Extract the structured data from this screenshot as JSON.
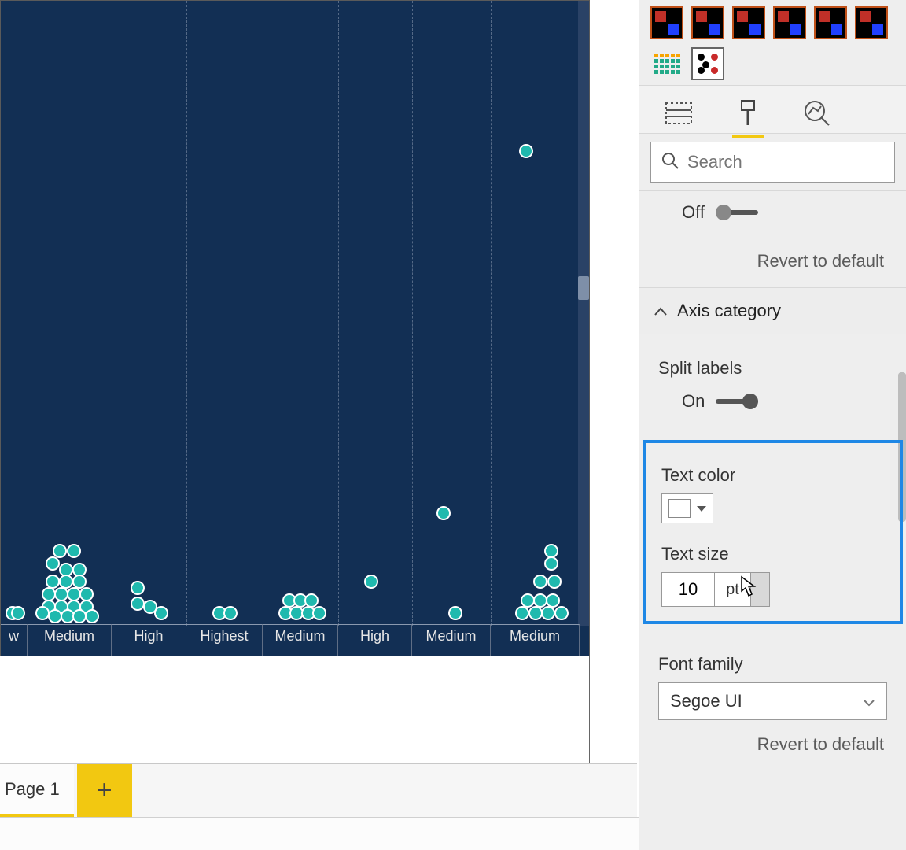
{
  "chart_data": {
    "type": "scatter",
    "note": "dot-plot / strip plot; x is categorical, y is relative height in the visible viewport (0 bottom → 1 top). Values are visual estimates.",
    "categories": [
      "w",
      "Medium",
      "High",
      "Highest",
      "Medium",
      "High",
      "Medium",
      "Medium"
    ],
    "title": "",
    "xlabel": "",
    "ylabel": "",
    "series": [
      {
        "name": "points",
        "values": [
          {
            "cat_index": 0,
            "x_off": 0.45,
            "y": 0.02
          },
          {
            "cat_index": 0,
            "x_off": 0.65,
            "y": 0.02
          },
          {
            "cat_index": 1,
            "x_off": 0.38,
            "y": 0.12
          },
          {
            "cat_index": 1,
            "x_off": 0.55,
            "y": 0.12
          },
          {
            "cat_index": 1,
            "x_off": 0.3,
            "y": 0.1
          },
          {
            "cat_index": 1,
            "x_off": 0.46,
            "y": 0.09
          },
          {
            "cat_index": 1,
            "x_off": 0.62,
            "y": 0.09
          },
          {
            "cat_index": 1,
            "x_off": 0.3,
            "y": 0.07
          },
          {
            "cat_index": 1,
            "x_off": 0.46,
            "y": 0.07
          },
          {
            "cat_index": 1,
            "x_off": 0.62,
            "y": 0.07
          },
          {
            "cat_index": 1,
            "x_off": 0.25,
            "y": 0.05
          },
          {
            "cat_index": 1,
            "x_off": 0.4,
            "y": 0.05
          },
          {
            "cat_index": 1,
            "x_off": 0.55,
            "y": 0.05
          },
          {
            "cat_index": 1,
            "x_off": 0.7,
            "y": 0.05
          },
          {
            "cat_index": 1,
            "x_off": 0.25,
            "y": 0.03
          },
          {
            "cat_index": 1,
            "x_off": 0.4,
            "y": 0.03
          },
          {
            "cat_index": 1,
            "x_off": 0.55,
            "y": 0.03
          },
          {
            "cat_index": 1,
            "x_off": 0.7,
            "y": 0.03
          },
          {
            "cat_index": 1,
            "x_off": 0.18,
            "y": 0.02
          },
          {
            "cat_index": 1,
            "x_off": 0.33,
            "y": 0.015
          },
          {
            "cat_index": 1,
            "x_off": 0.48,
            "y": 0.015
          },
          {
            "cat_index": 1,
            "x_off": 0.62,
            "y": 0.015
          },
          {
            "cat_index": 1,
            "x_off": 0.77,
            "y": 0.015
          },
          {
            "cat_index": 2,
            "x_off": 0.35,
            "y": 0.06
          },
          {
            "cat_index": 2,
            "x_off": 0.35,
            "y": 0.035
          },
          {
            "cat_index": 2,
            "x_off": 0.52,
            "y": 0.03
          },
          {
            "cat_index": 2,
            "x_off": 0.66,
            "y": 0.02
          },
          {
            "cat_index": 3,
            "x_off": 0.43,
            "y": 0.02
          },
          {
            "cat_index": 3,
            "x_off": 0.58,
            "y": 0.02
          },
          {
            "cat_index": 4,
            "x_off": 0.35,
            "y": 0.04
          },
          {
            "cat_index": 4,
            "x_off": 0.5,
            "y": 0.04
          },
          {
            "cat_index": 4,
            "x_off": 0.65,
            "y": 0.04
          },
          {
            "cat_index": 4,
            "x_off": 0.3,
            "y": 0.02
          },
          {
            "cat_index": 4,
            "x_off": 0.45,
            "y": 0.02
          },
          {
            "cat_index": 4,
            "x_off": 0.6,
            "y": 0.02
          },
          {
            "cat_index": 4,
            "x_off": 0.75,
            "y": 0.02
          },
          {
            "cat_index": 5,
            "x_off": 0.45,
            "y": 0.07
          },
          {
            "cat_index": 6,
            "x_off": 0.4,
            "y": 0.18
          },
          {
            "cat_index": 6,
            "x_off": 0.55,
            "y": 0.02
          },
          {
            "cat_index": 7,
            "x_off": 0.4,
            "y": 0.76
          },
          {
            "cat_index": 7,
            "x_off": 0.68,
            "y": 0.12
          },
          {
            "cat_index": 7,
            "x_off": 0.68,
            "y": 0.1
          },
          {
            "cat_index": 7,
            "x_off": 0.56,
            "y": 0.07
          },
          {
            "cat_index": 7,
            "x_off": 0.72,
            "y": 0.07
          },
          {
            "cat_index": 7,
            "x_off": 0.42,
            "y": 0.04
          },
          {
            "cat_index": 7,
            "x_off": 0.56,
            "y": 0.04
          },
          {
            "cat_index": 7,
            "x_off": 0.7,
            "y": 0.04
          },
          {
            "cat_index": 7,
            "x_off": 0.35,
            "y": 0.02
          },
          {
            "cat_index": 7,
            "x_off": 0.5,
            "y": 0.02
          },
          {
            "cat_index": 7,
            "x_off": 0.65,
            "y": 0.02
          },
          {
            "cat_index": 7,
            "x_off": 0.8,
            "y": 0.02
          }
        ]
      }
    ]
  },
  "canvas": {
    "bg": "#122f54",
    "grid_positions_pct": [
      4,
      18,
      31,
      44,
      57,
      69,
      82
    ]
  },
  "tabs": {
    "page_label": "Page 1",
    "add_label": "+"
  },
  "panel": {
    "search_placeholder": "Search",
    "off_label": "Off",
    "revert_label": "Revert to default",
    "axis_category_label": "Axis category",
    "split_labels_label": "Split labels",
    "on_label": "On",
    "text_color_label": "Text color",
    "text_size_label": "Text size",
    "text_size_value": "10",
    "text_size_unit": "pt",
    "font_family_label": "Font family",
    "font_family_value": "Segoe UI",
    "text_color_value": "#ffffff"
  }
}
